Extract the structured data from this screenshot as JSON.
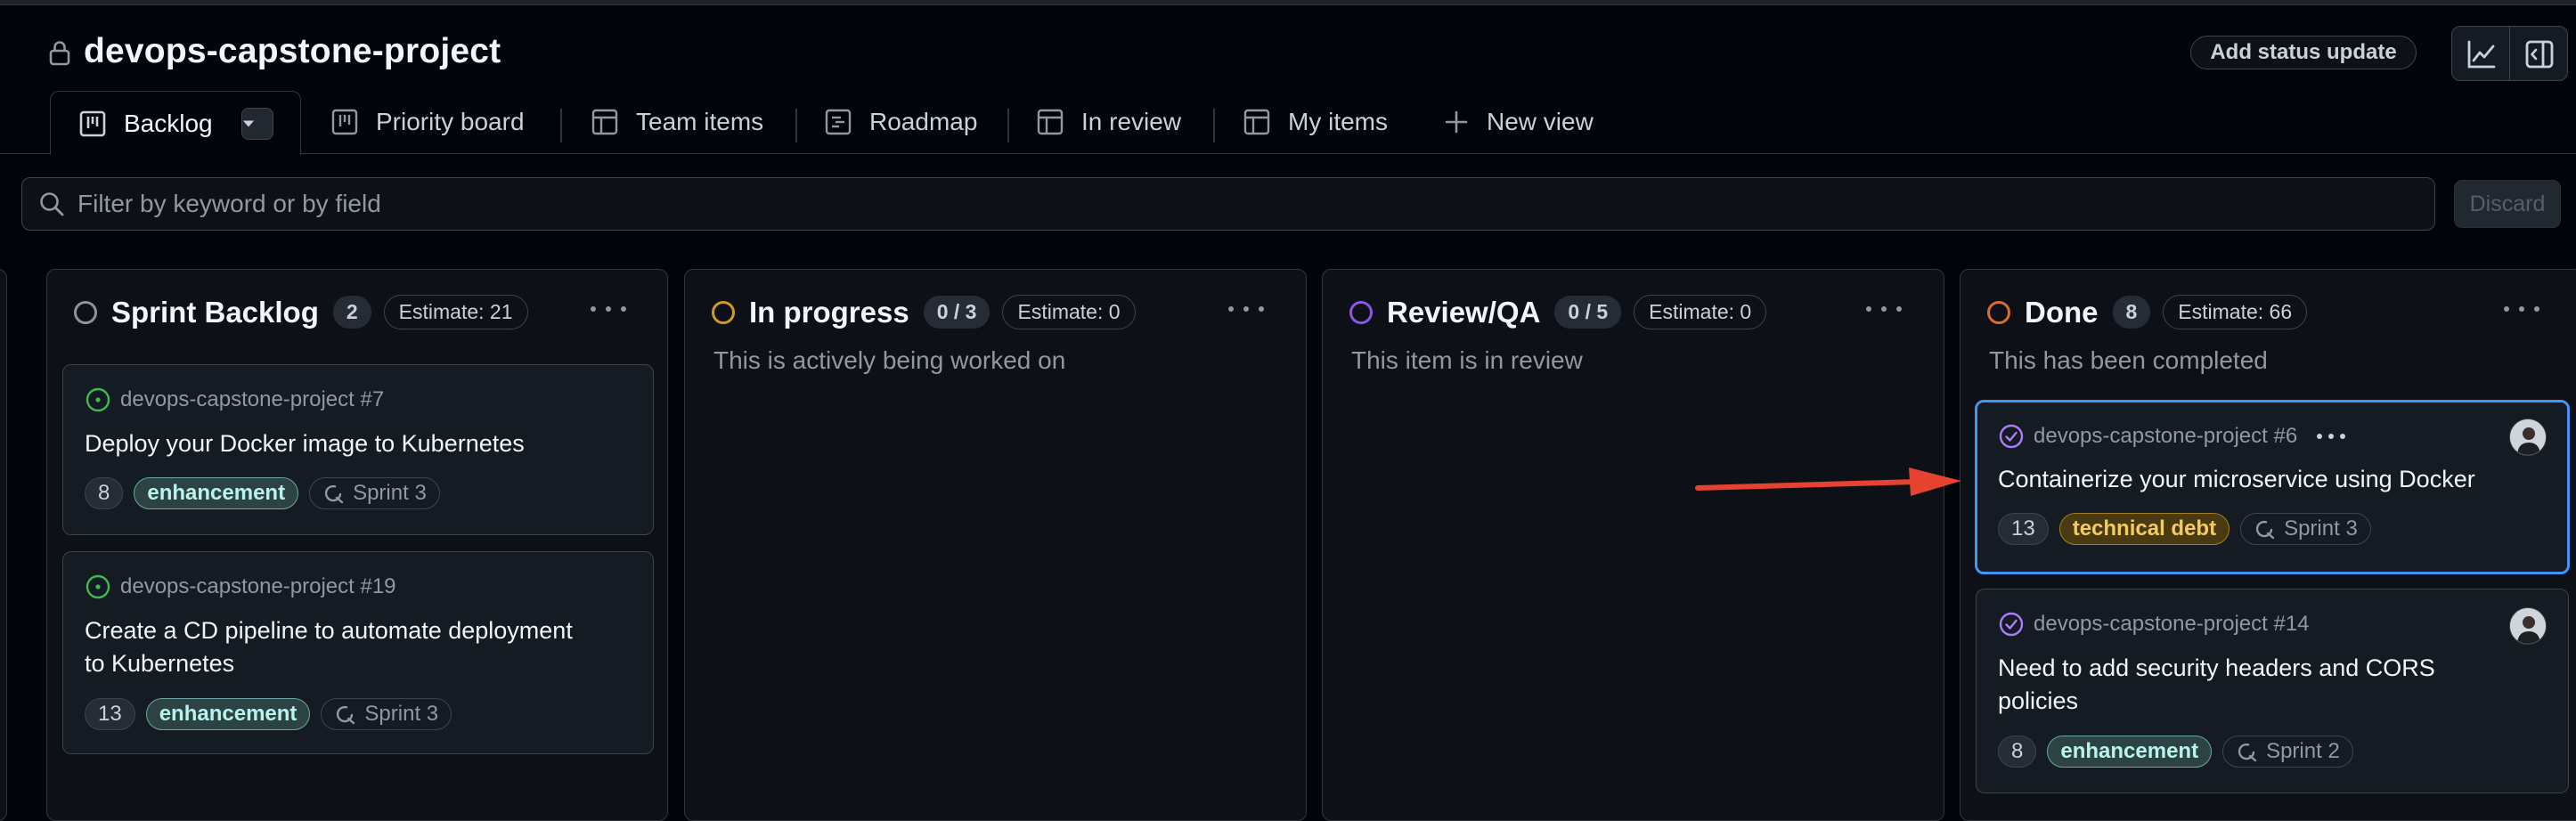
{
  "header": {
    "project_title": "devops-capstone-project",
    "add_status_label": "Add status update"
  },
  "tabs": [
    {
      "label": "Backlog",
      "icon": "board-icon",
      "active": true
    },
    {
      "label": "Priority board",
      "icon": "board-icon"
    },
    {
      "label": "Team items",
      "icon": "table-icon"
    },
    {
      "label": "Roadmap",
      "icon": "roadmap-icon"
    },
    {
      "label": "In review",
      "icon": "table-icon"
    },
    {
      "label": "My items",
      "icon": "table-icon"
    },
    {
      "label": "New view",
      "icon": "plus-icon"
    }
  ],
  "filter": {
    "placeholder": "Filter by keyword or by field",
    "discard_label": "Discard"
  },
  "columns": [
    {
      "title": "Sprint Backlog",
      "count": "2",
      "estimate": "Estimate: 21",
      "status_color": "#8b949e",
      "cards": [
        {
          "ref": "devops-capstone-project #7",
          "title": "Deploy your Docker image to Kubernetes",
          "estimate": "8",
          "label": "enhancement",
          "sprint": "Sprint 3"
        },
        {
          "ref": "devops-capstone-project #19",
          "title": "Create a CD pipeline to automate deployment",
          "title2": "to Kubernetes",
          "estimate": "13",
          "label": "enhancement",
          "sprint": "Sprint 3"
        }
      ]
    },
    {
      "title": "In progress",
      "count": "0 / 3",
      "estimate": "Estimate: 0",
      "status_color": "#d29922",
      "description": "This is actively being worked on"
    },
    {
      "title": "Review/QA",
      "count": "0 / 5",
      "estimate": "Estimate: 0",
      "status_color": "#8957e5",
      "description": "This item is in review"
    },
    {
      "title": "Done",
      "count": "8",
      "estimate": "Estimate: 66",
      "status_color": "#db6d28",
      "description": "This has been completed",
      "cards": [
        {
          "ref": "devops-capstone-project #6",
          "title": "Containerize your microservice using Docker",
          "estimate": "13",
          "label": "technical debt",
          "sprint": "Sprint 3",
          "selected": true
        },
        {
          "ref": "devops-capstone-project #14",
          "title": "Need to add security headers and CORS",
          "title2": "policies",
          "estimate": "8",
          "label": "enhancement",
          "sprint": "Sprint 2"
        }
      ]
    }
  ],
  "colors": {
    "background": "#010409",
    "column_bg": "#0d1117",
    "selection_border": "#4493f8",
    "arrow": "#e5432f",
    "open_issue": "#3fb950",
    "closed_issue": "#ab7df8"
  }
}
